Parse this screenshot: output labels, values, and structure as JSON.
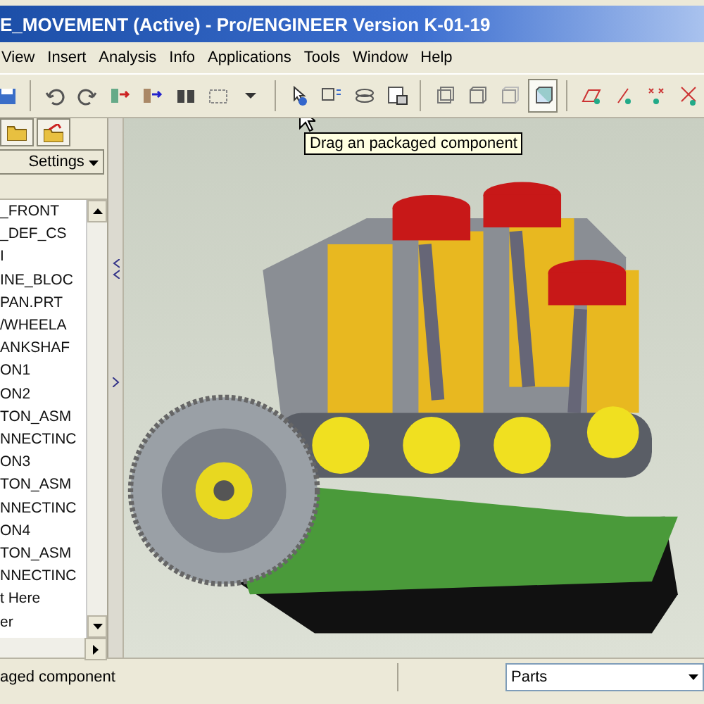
{
  "window": {
    "title": "E_MOVEMENT (Active) - Pro/ENGINEER Version K-01-19"
  },
  "menu": [
    "View",
    "Insert",
    "Analysis",
    "Info",
    "Applications",
    "Tools",
    "Window",
    "Help"
  ],
  "toolbar": [
    {
      "pressed": false
    },
    {
      "pressed": false
    },
    {
      "pressed": false
    },
    {
      "pressed": false
    },
    {
      "pressed": false
    },
    {
      "pressed": false
    },
    {
      "pressed": false
    },
    {
      "pressed": false
    },
    {
      "pressed": false
    },
    {
      "pressed": false
    },
    {
      "pressed": false
    },
    {
      "pressed": false
    },
    {
      "pressed": false
    },
    {
      "pressed": false
    },
    {
      "pressed": false
    },
    {
      "pressed": true
    },
    {
      "pressed": false
    },
    {
      "pressed": false
    },
    {
      "pressed": false
    },
    {
      "pressed": false
    }
  ],
  "tooltip": "Drag an packaged component",
  "sidebar": {
    "settings_button": "Settings",
    "items": [
      "_FRONT",
      "_DEF_CS",
      "I",
      "INE_BLOC",
      "PAN.PRT",
      "/WHEELA",
      "ANKSHAF",
      "ON1",
      "ON2",
      "TON_ASM",
      "NNECTINC",
      "ON3",
      "TON_ASM",
      "NNECTINC",
      "ON4",
      "TON_ASM",
      "NNECTINC",
      "t Here",
      "er"
    ]
  },
  "status_bar": {
    "message": "aged component",
    "filter": "Parts"
  }
}
